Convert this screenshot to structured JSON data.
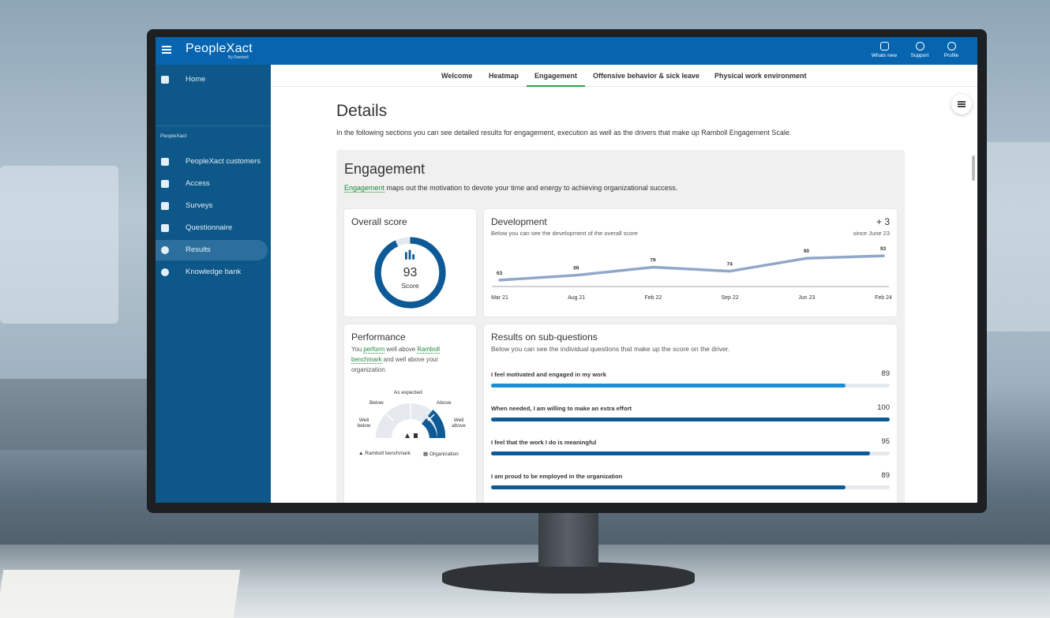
{
  "app": {
    "logo": "PeopleXact",
    "logo_sub": "By Ramboll"
  },
  "topbar": {
    "actions": [
      {
        "label": "Whats new",
        "icon": "gift-icon"
      },
      {
        "label": "Support",
        "icon": "headset-icon"
      },
      {
        "label": "Profile",
        "icon": "profile-icon"
      }
    ]
  },
  "sidebar": {
    "home": "Home",
    "section": "PeopleXact",
    "items": [
      {
        "label": "PeopleXact customers",
        "icon": "store-icon"
      },
      {
        "label": "Access",
        "icon": "shield-icon"
      },
      {
        "label": "Surveys",
        "icon": "clipboard-icon"
      },
      {
        "label": "Questionnaire",
        "icon": "chat-icon"
      },
      {
        "label": "Results",
        "icon": "pie-chart-icon",
        "active": true
      },
      {
        "label": "Knowledge bank",
        "icon": "help-icon"
      }
    ]
  },
  "tabs": [
    "Welcome",
    "Heatmap",
    "Engagement",
    "Offensive behavior & sick leave",
    "Physical work environment"
  ],
  "details": {
    "title": "Details",
    "desc": "In the following sections you can see detailed results for engagement, execution as well as the drivers that make up Ramboll Engagement Scale."
  },
  "engagement": {
    "title": "Engagement",
    "link": "Engagement",
    "desc": " maps out the motivation to devote your time and energy to achieving organizational success."
  },
  "overall": {
    "title": "Overall score",
    "value": "93",
    "label": "Score",
    "fraction": 0.93
  },
  "development": {
    "title": "Development",
    "sub": "Below you can see the development of the overall score",
    "delta": "+ 3",
    "since": "since June 23"
  },
  "chart_data": {
    "type": "line",
    "x": [
      "Mar 21",
      "Aug 21",
      "Feb 22",
      "Sep 22",
      "Jun 23",
      "Feb 24"
    ],
    "values": [
      63,
      69,
      79,
      74,
      90,
      93
    ],
    "ylim": [
      0,
      100
    ],
    "title": "Development",
    "color": "#8fa8c8"
  },
  "performance": {
    "title": "Performance",
    "t1": "You ",
    "l1": "perform",
    "t2": " well above ",
    "l2": "Ramboll benchmark",
    "t3": " and well above your organization.",
    "gauge": {
      "as_expected": "As expected",
      "below": "Below",
      "above": "Above",
      "well_below": "Well below",
      "well_above": "Well above"
    },
    "legend": {
      "benchmark": "Ramboll benchmark",
      "org": "Organization"
    }
  },
  "subq": {
    "title": "Results on sub-questions",
    "sub": "Below you can see the individual questions that make up the score on the driver.",
    "rows": [
      {
        "q": "I feel motivated and engaged in my work",
        "v": "89",
        "frac": 0.89,
        "color": "#1a8fd6"
      },
      {
        "q": "When needed, I am willing to make an extra effort",
        "v": "100",
        "frac": 1.0,
        "color": "#0d5a96"
      },
      {
        "q": "I feel that the work I do is meaningful",
        "v": "95",
        "frac": 0.95,
        "color": "#0d5a96"
      },
      {
        "q": "I am proud to be employed in the organization",
        "v": "89",
        "frac": 0.89,
        "color": "#0d5a96"
      }
    ]
  }
}
